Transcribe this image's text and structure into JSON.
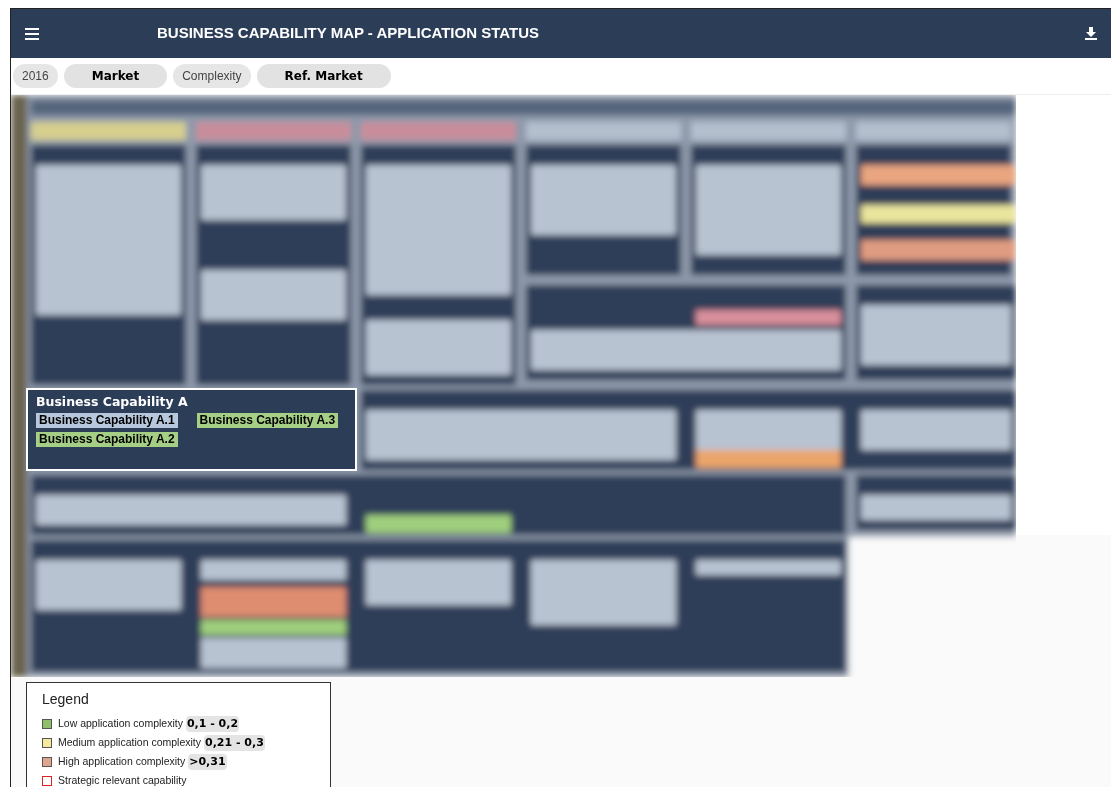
{
  "header": {
    "title": "BUSINESS CAPABILITY MAP - APPLICATION STATUS"
  },
  "filters": [
    {
      "label": "2016",
      "selected": false
    },
    {
      "label": "Market",
      "selected": true
    },
    {
      "label": "Complexity",
      "selected": false
    },
    {
      "label": "Ref. Market",
      "selected": true
    }
  ],
  "capability": {
    "title": "Business Capability A",
    "items": [
      {
        "label": "Business Capability A.1",
        "color": "#b7c7dc"
      },
      {
        "label": "Business Capability A.3",
        "color": "#a6cf86"
      },
      {
        "label": "Business Capability A.2",
        "color": "#a6cf86"
      }
    ]
  },
  "legend": {
    "title": "Legend",
    "items": [
      {
        "kind": "fill",
        "color": "#8fbf6b",
        "label": "Low application complexity",
        "range": "0,1 - 0,2"
      },
      {
        "kind": "fill",
        "color": "#f3ea9c",
        "label": "Medium application complexity",
        "range": "0,21 - 0,3"
      },
      {
        "kind": "fill",
        "color": "#e0a58c",
        "label": "High application complexity",
        "range": ">0,31"
      },
      {
        "kind": "outline",
        "color": "#e02020",
        "label": "Strategic relevant capability"
      }
    ]
  }
}
